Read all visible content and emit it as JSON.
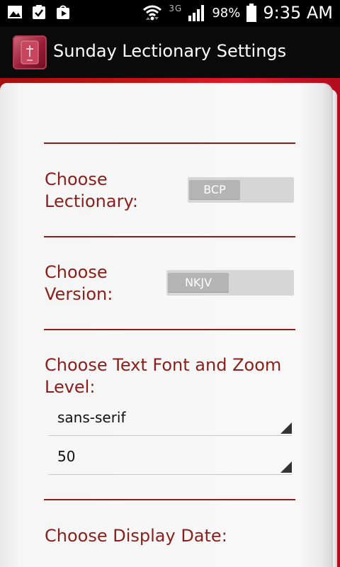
{
  "status_bar": {
    "network": "3G",
    "battery": "98%",
    "time": "9:35 AM"
  },
  "action_bar": {
    "title": "Sunday Lectionary Settings"
  },
  "settings": {
    "lectionary": {
      "label": "Choose\nLectionary:",
      "value": "BCP"
    },
    "version": {
      "label": "Choose\nVersion:",
      "value": "NKJV"
    },
    "font_zoom": {
      "label": "Choose Text Font and Zoom Level:",
      "font_value": "sans-serif",
      "zoom_value": "50"
    },
    "display_date": {
      "label": "Choose Display Date:"
    }
  },
  "colors": {
    "accent": "#8a1f1a",
    "book_red": "#c41212"
  }
}
